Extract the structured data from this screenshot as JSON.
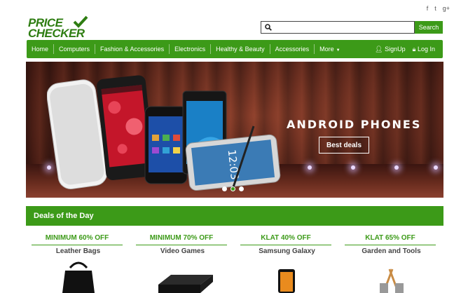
{
  "social": {
    "facebook": "f",
    "twitter": "t",
    "googleplus": "g+"
  },
  "logo": {
    "line1": "PRICE",
    "line2": "CHECKER"
  },
  "search": {
    "placeholder": "",
    "button": "Search"
  },
  "nav": {
    "items": [
      "Home",
      "Computers",
      "Fashion & Accessories",
      "Electronics",
      "Healthy & Beauty",
      "Accessories",
      "More"
    ],
    "signup": "SignUp",
    "login": "Log In"
  },
  "hero": {
    "title": "ANDROID PHONES",
    "button": "Best deals",
    "phone_screen_time": "12:03",
    "slides": 3,
    "active_slide": 2
  },
  "deals": {
    "heading": "Deals of the Day",
    "cards": [
      {
        "offer": "MINIMUM 60% OFF",
        "name": "Leather Bags"
      },
      {
        "offer": "MINIMUM 70% OFF",
        "name": "Video Games"
      },
      {
        "offer": "KLAT 40% OFF",
        "name": "Samsung Galaxy"
      },
      {
        "offer": "KLAT 65% OFF",
        "name": "Garden and Tools"
      }
    ]
  },
  "colors": {
    "accent": "#3c9a18",
    "logo": "#2e7d12",
    "hero_wood": "#6a2a1e"
  }
}
